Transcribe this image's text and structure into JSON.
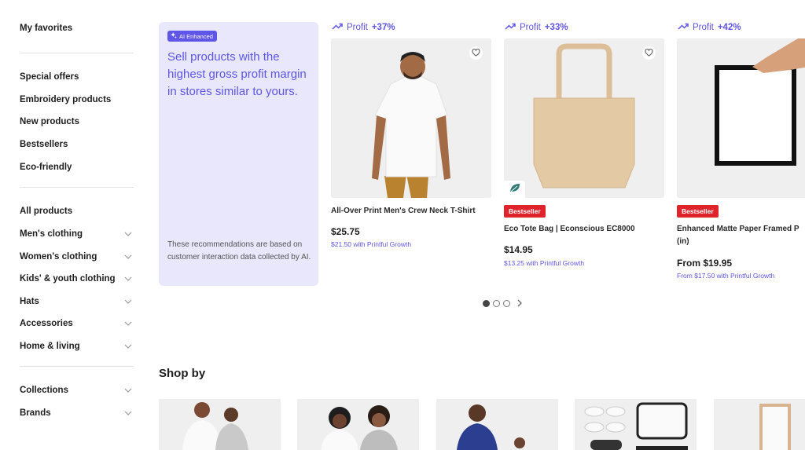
{
  "sidebar": {
    "favorites": "My favorites",
    "group1": [
      "Special offers",
      "Embroidery products",
      "New products",
      "Bestsellers",
      "Eco-friendly"
    ],
    "all_products": "All products",
    "categories": [
      "Men's clothing",
      "Women's clothing",
      "Kids' & youth clothing",
      "Hats",
      "Accessories",
      "Home & living"
    ],
    "collections": "Collections",
    "brands": "Brands"
  },
  "ai_card": {
    "badge": "AI Enhanced",
    "headline": "Sell products with the highest gross profit margin in stores similar to yours.",
    "note": "These recommendations are based on customer interaction data collected by AI."
  },
  "products": [
    {
      "profit_label": "Profit",
      "profit_value": "+37%",
      "name": "All-Over Print Men's Crew Neck T-Shirt",
      "price": "$25.75",
      "growth": "$21.50 with Printful Growth"
    },
    {
      "profit_label": "Profit",
      "profit_value": "+33%",
      "badge": "Bestseller",
      "name": "Eco Tote Bag | Econscious EC8000",
      "price": "$14.95",
      "growth": "$13.25 with Printful Growth"
    },
    {
      "profit_label": "Profit",
      "profit_value": "+42%",
      "badge": "Bestseller",
      "name": "Enhanced Matte Paper Framed P (in)",
      "price": "From $19.95",
      "growth": "From $17.50 with Printful Growth"
    }
  ],
  "pagination": {
    "pages": 3,
    "current": 1
  },
  "shop_by": {
    "title": "Shop by"
  },
  "colors": {
    "accent": "#5f55e6",
    "ai_card_bg": "#e8e7fb",
    "bestseller": "#e0242b"
  },
  "icons": [
    "heart-icon",
    "trending-up-icon",
    "sparkle-icon",
    "leaf-icon",
    "chevron-down-icon",
    "chevron-right-icon"
  ]
}
